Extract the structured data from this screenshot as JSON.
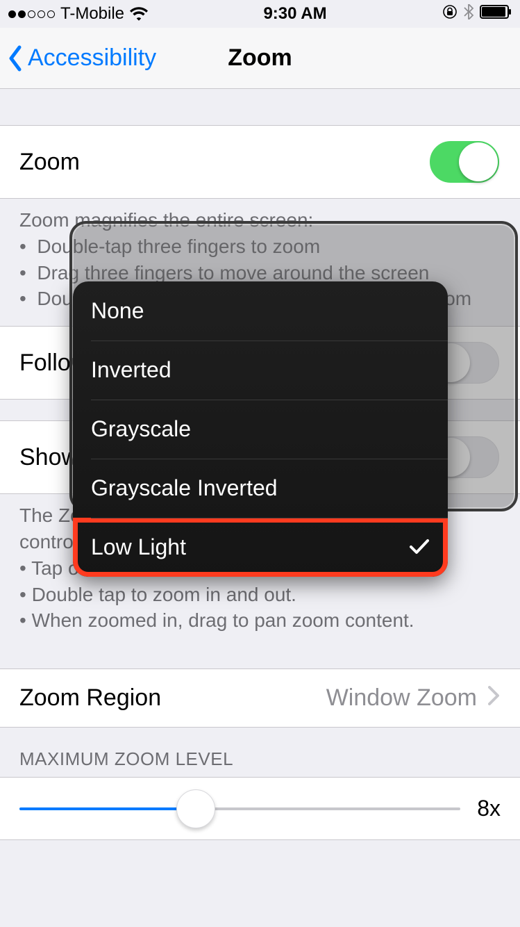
{
  "status": {
    "carrier": "T-Mobile",
    "time": "9:30 AM"
  },
  "nav": {
    "back_label": "Accessibility",
    "title": "Zoom"
  },
  "cells": {
    "zoom_label": "Zoom",
    "follow_focus_label": "Follow Focus",
    "show_controller_label": "Show Controller",
    "zoom_region_label": "Zoom Region",
    "zoom_region_value": "Window Zoom"
  },
  "footers": {
    "zoom_help_heading": "Zoom magnifies the entire screen:",
    "zoom_help_b1": "Double-tap three fingers to zoom",
    "zoom_help_b2": "Drag three fingers to move around the screen",
    "zoom_help_b3": "Double-tap three fingers and drag to change zoom",
    "controller_l1": "The Zoom controller allows quick access to zoom controls.",
    "controller_l2": "• Tap once to show the Zoom menu.",
    "controller_l3": "• Double tap to zoom in and out.",
    "controller_l4": "• When zoomed in, drag to pan zoom content."
  },
  "section": {
    "max_zoom_header": "MAXIMUM ZOOM LEVEL",
    "max_zoom_value": "8x"
  },
  "popup": {
    "options": [
      "None",
      "Inverted",
      "Grayscale",
      "Grayscale Inverted",
      "Low Light"
    ],
    "selected_index": 4
  }
}
